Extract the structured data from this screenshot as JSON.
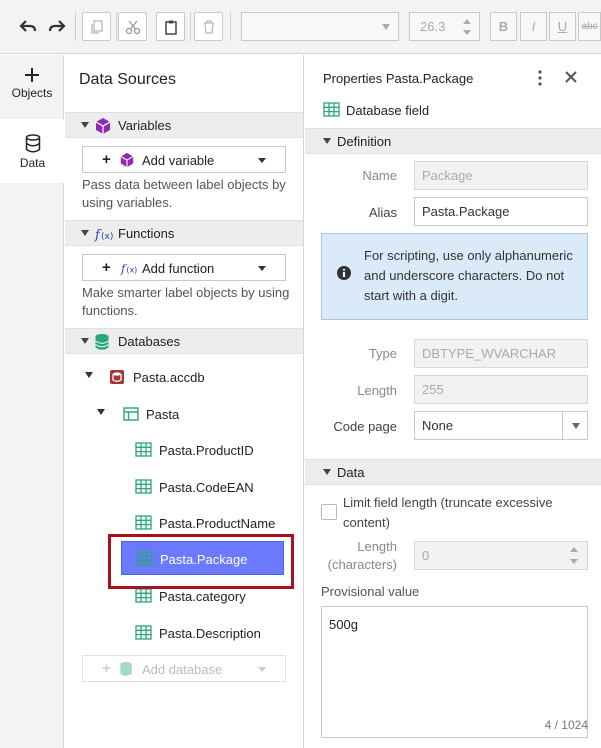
{
  "toolbar": {
    "font_size": "26.3",
    "bold_label": "B",
    "italic_label": "I",
    "underline_label": "U",
    "strike_label": "abc"
  },
  "rail": {
    "items": [
      {
        "label": "Objects",
        "icon": "plus-icon"
      },
      {
        "label": "Data",
        "icon": "database-icon",
        "active": true
      }
    ]
  },
  "data_sources": {
    "title": "Data Sources",
    "variables": {
      "header": "Variables",
      "add_label": "Add variable",
      "description": "Pass data between label objects by using variables."
    },
    "functions": {
      "header": "Functions",
      "add_label": "Add function",
      "description": "Make smarter label objects by using functions."
    },
    "databases": {
      "header": "Databases",
      "tree": {
        "database": "Pasta.accdb",
        "table": "Pasta",
        "fields": [
          "Pasta.ProductID",
          "Pasta.CodeEAN",
          "Pasta.ProductName",
          "Pasta.Package",
          "Pasta.category",
          "Pasta.Description"
        ],
        "selected": "Pasta.Package"
      },
      "add_label": "Add database"
    }
  },
  "properties": {
    "title_prefix": "Properties",
    "title_name": "Pasta.Package",
    "subtitle": "Database field",
    "definition": {
      "header": "Definition",
      "name_label": "Name",
      "name_value": "Package",
      "alias_label": "Alias",
      "alias_value": "Pasta.Package",
      "info_text": "For scripting, use only alphanumeric and underscore characters. Do not start with a digit.",
      "type_label": "Type",
      "type_value": "DBTYPE_WVARCHAR",
      "length_label": "Length",
      "length_value": "255",
      "codepage_label": "Code page",
      "codepage_value": "None"
    },
    "data": {
      "header": "Data",
      "limit_label": "Limit field length (truncate excessive content)",
      "length_chars_label_1": "Length",
      "length_chars_label_2": "(characters)",
      "length_chars_value": "0",
      "provisional_label": "Provisional value",
      "provisional_value": "500g",
      "counter": "4 / 1024"
    }
  },
  "colors": {
    "selected_row": "#6b79ff",
    "highlight_outline": "#a4131c",
    "info_bg": "#dbeaf8",
    "variables_icon": "#8e2bb3",
    "databases_icon": "#2aa57f"
  }
}
